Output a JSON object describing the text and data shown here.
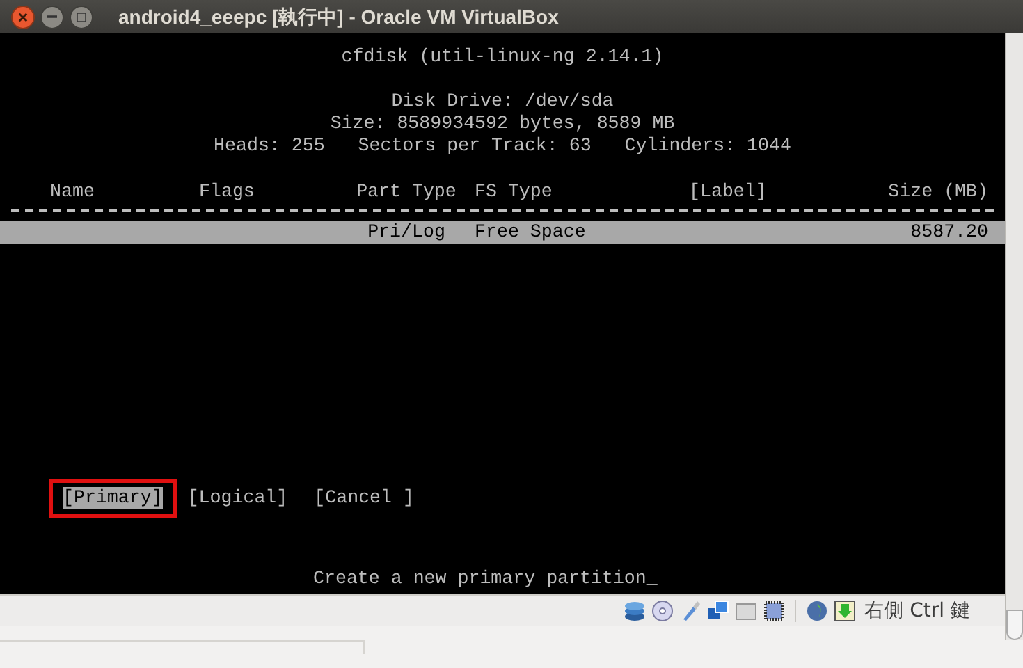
{
  "window": {
    "title": "android4_eeepc [執行中] - Oracle VM VirtualBox"
  },
  "terminal": {
    "program": "cfdisk (util-linux-ng 2.14.1)",
    "info_lines": [
      "Disk Drive: /dev/sda",
      "Size: 8589934592 bytes, 8589 MB",
      "Heads: 255   Sectors per Track: 63   Cylinders: 1044"
    ],
    "table": {
      "columns": [
        "Name",
        "Flags",
        "Part Type",
        "FS Type",
        "[Label]",
        "Size (MB)"
      ],
      "rows": [
        {
          "selected": true,
          "part_type": "Pri/Log",
          "fs_type": "Free Space",
          "size": "8587.20"
        }
      ]
    },
    "buttons": [
      {
        "label": "[Primary]",
        "selected": true
      },
      {
        "label": "[Logical]",
        "selected": false
      },
      {
        "label": "[Cancel ]",
        "selected": false
      }
    ],
    "message": "Create a new primary partition",
    "cursor": "_"
  },
  "status_bar": {
    "host_key": "右側 Ctrl 鍵"
  }
}
